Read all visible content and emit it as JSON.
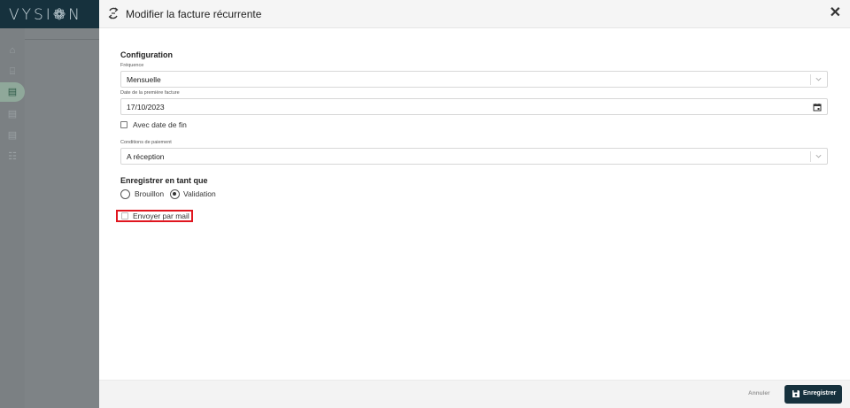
{
  "app": {
    "logo": "VYSI❁N"
  },
  "sidebar": {
    "items": [
      {
        "icon": "home-icon",
        "glyph": "⌂"
      },
      {
        "icon": "bank-icon",
        "glyph": "⌸"
      },
      {
        "icon": "invoice-icon",
        "glyph": "▤",
        "active": true
      },
      {
        "icon": "invoice-edit-icon",
        "glyph": "▤"
      },
      {
        "icon": "document-icon",
        "glyph": "▤"
      },
      {
        "icon": "team-icon",
        "glyph": "☷"
      }
    ]
  },
  "modal": {
    "title": "Modifier la facture récurrente",
    "close_label": "✕"
  },
  "form": {
    "configuration_title": "Configuration",
    "frequence": {
      "label": "Fréquence",
      "value": "Mensuelle"
    },
    "first_invoice_date": {
      "label": "Date de la première facture",
      "value": "17/10/2023"
    },
    "end_date_checkbox": {
      "label": "Avec date de fin",
      "checked": false
    },
    "payment_conditions": {
      "label": "Conditions de paiement",
      "value": "A réception"
    },
    "save_as_title": "Enregistrer en tant que",
    "save_as_options": [
      {
        "label": "Brouillon",
        "selected": false
      },
      {
        "label": "Validation",
        "selected": true
      }
    ],
    "send_mail_checkbox": {
      "label": "Envoyer par mail",
      "checked": false
    }
  },
  "footer": {
    "cancel_label": "Annuler",
    "save_label": "Enregistrer"
  },
  "colors": {
    "brand_dark": "#16313d",
    "highlight": "#e0161f",
    "active_nav": "#8fa89a"
  }
}
